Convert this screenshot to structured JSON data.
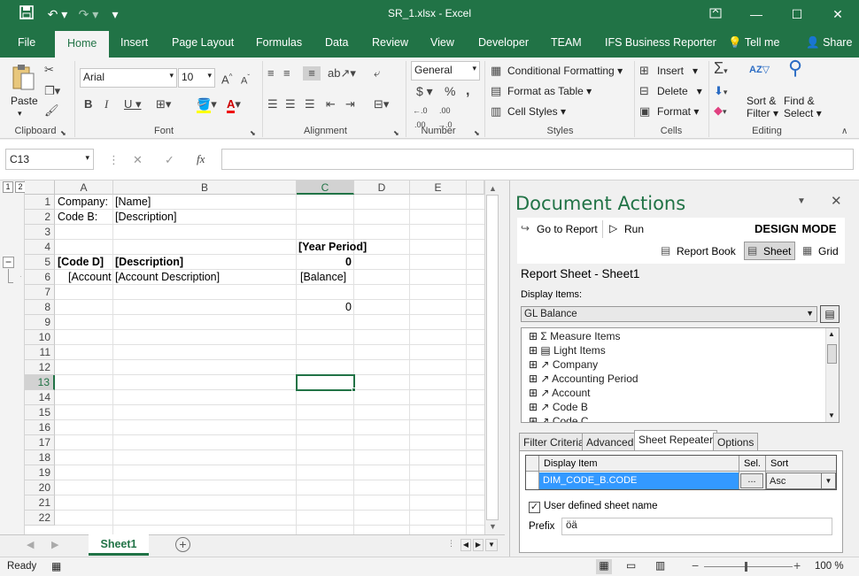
{
  "window": {
    "title": "SR_1.xlsx - Excel"
  },
  "tabs": [
    {
      "label": "File"
    },
    {
      "label": "Home"
    },
    {
      "label": "Insert"
    },
    {
      "label": "Page Layout"
    },
    {
      "label": "Formulas"
    },
    {
      "label": "Data"
    },
    {
      "label": "Review"
    },
    {
      "label": "View"
    },
    {
      "label": "Developer"
    },
    {
      "label": "TEAM"
    },
    {
      "label": "IFS Business Reporter"
    },
    {
      "label": "Tell me"
    },
    {
      "label": "Share"
    }
  ],
  "ribbon": {
    "clipboard": {
      "paste": "Paste",
      "label": "Clipboard"
    },
    "font": {
      "name": "Arial",
      "size": "10",
      "label": "Font"
    },
    "alignment": {
      "label": "Alignment"
    },
    "number": {
      "format": "General",
      "label": "Number",
      "dollar": "$",
      "percent": "%",
      "comma": ","
    },
    "styles": {
      "conditional": "Conditional Formatting",
      "table": "Format as Table",
      "cell": "Cell Styles",
      "label": "Styles"
    },
    "cells": {
      "insert": "Insert",
      "delete": "Delete",
      "format": "Format",
      "label": "Cells"
    },
    "editing": {
      "sort": "Sort &",
      "filter": "Filter",
      "find": "Find &",
      "select": "Select",
      "label": "Editing"
    }
  },
  "formula_bar": {
    "name_box": "C13",
    "fx": "fx",
    "formula": ""
  },
  "grid": {
    "outline_levels": [
      "1",
      "2"
    ],
    "columns": [
      "A",
      "B",
      "C",
      "D",
      "E"
    ],
    "rows": [
      "1",
      "2",
      "3",
      "4",
      "5",
      "6",
      "7",
      "8",
      "9",
      "10",
      "11",
      "12",
      "13",
      "14",
      "15",
      "16",
      "17",
      "18",
      "19",
      "20",
      "21",
      "22"
    ],
    "cells": {
      "A1": "Company:",
      "B1": "[Name]",
      "A2": "Code B:",
      "B2": "[Description]",
      "C4": "[Year Period]",
      "A5": "[Code D]",
      "B5": "[Description]",
      "C5": "0",
      "A6": "[Account",
      "B6": "[Account Description]",
      "C6": "[Balance]",
      "C8": "0"
    },
    "selected": "C13",
    "outline_collapse": "−"
  },
  "sheets": [
    {
      "name": "Sheet1"
    }
  ],
  "status": {
    "ready": "Ready",
    "zoom": "100 %"
  },
  "pane": {
    "title": "Document Actions",
    "go_to_report": "Go to Report",
    "run": "Run",
    "mode": "DESIGN MODE",
    "report_book": "Report Book",
    "sheet": "Sheet",
    "grid": "Grid",
    "report_sheet": "Report Sheet - Sheet1",
    "display_items_label": "Display Items:",
    "display_items_value": "GL Balance",
    "tree": [
      "Measure Items",
      "Light Items",
      "Company",
      "Accounting Period",
      "Account",
      "Code B",
      "Code C"
    ],
    "subtabs": [
      "Filter Criteria",
      "Advanced",
      "Sheet Repeater",
      "Options"
    ],
    "table_headers": [
      "Display Item",
      "Sel.",
      "Sort"
    ],
    "table_row": {
      "item": "DIM_CODE_B.CODE",
      "sel": "...",
      "sort": "Asc"
    },
    "checkbox_label": "User defined sheet name",
    "prefix_label": "Prefix",
    "prefix_value": "öä"
  },
  "colors": {
    "excel_green": "#217346",
    "selection_blue": "#3399ff"
  }
}
